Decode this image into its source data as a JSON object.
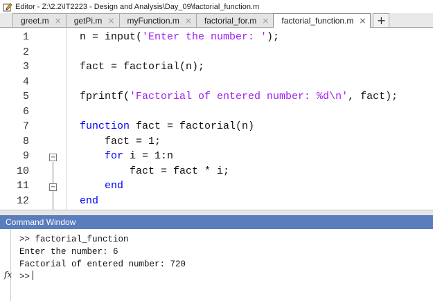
{
  "window": {
    "title": "Editor - Z:\\2.2\\IT2223 - Design and Analysis\\Day_09\\factorial_function.m"
  },
  "tabs": [
    {
      "label": "greet.m",
      "active": false
    },
    {
      "label": "getPi.m",
      "active": false
    },
    {
      "label": "myFunction.m",
      "active": false
    },
    {
      "label": "factorial_for.m",
      "active": false
    },
    {
      "label": "factorial_function.m",
      "active": true
    }
  ],
  "tab_close_glyph": "×",
  "add_tab_glyph": "+",
  "editor": {
    "lines": [
      {
        "num": "1",
        "segments": [
          {
            "t": "n = input(",
            "c": "plain"
          },
          {
            "t": "'Enter the number: '",
            "c": "str"
          },
          {
            "t": ");",
            "c": "plain"
          }
        ]
      },
      {
        "num": "2",
        "segments": []
      },
      {
        "num": "3",
        "segments": [
          {
            "t": "fact = factorial(n);",
            "c": "plain"
          }
        ]
      },
      {
        "num": "4",
        "segments": []
      },
      {
        "num": "5",
        "segments": [
          {
            "t": "fprintf(",
            "c": "plain"
          },
          {
            "t": "'Factorial of entered number: %d\\n'",
            "c": "str"
          },
          {
            "t": ", fact);",
            "c": "plain"
          }
        ]
      },
      {
        "num": "6",
        "segments": []
      },
      {
        "num": "7",
        "segments": [
          {
            "t": "function",
            "c": "kw"
          },
          {
            "t": " fact = factorial(n)",
            "c": "plain"
          }
        ]
      },
      {
        "num": "8",
        "segments": [
          {
            "t": "    fact = 1;",
            "c": "plain"
          }
        ]
      },
      {
        "num": "9",
        "segments": [
          {
            "t": "    ",
            "c": "plain"
          },
          {
            "t": "for",
            "c": "kw"
          },
          {
            "t": " i = 1:n",
            "c": "plain"
          }
        ]
      },
      {
        "num": "10",
        "segments": [
          {
            "t": "        fact = fact * i;",
            "c": "plain"
          }
        ]
      },
      {
        "num": "11",
        "segments": [
          {
            "t": "    ",
            "c": "plain"
          },
          {
            "t": "end",
            "c": "kw"
          }
        ]
      },
      {
        "num": "12",
        "segments": [
          {
            "t": "end",
            "c": "kw"
          }
        ]
      }
    ]
  },
  "command_window": {
    "title": "Command Window",
    "lines": [
      ">> factorial_function",
      "Enter the number: 6",
      "Factorial of entered number: 720"
    ],
    "prompt": ">>",
    "fx_label": "fx"
  },
  "colors": {
    "keyword": "#0000ff",
    "string": "#a020f0",
    "command_header": "#5a7dbd"
  }
}
